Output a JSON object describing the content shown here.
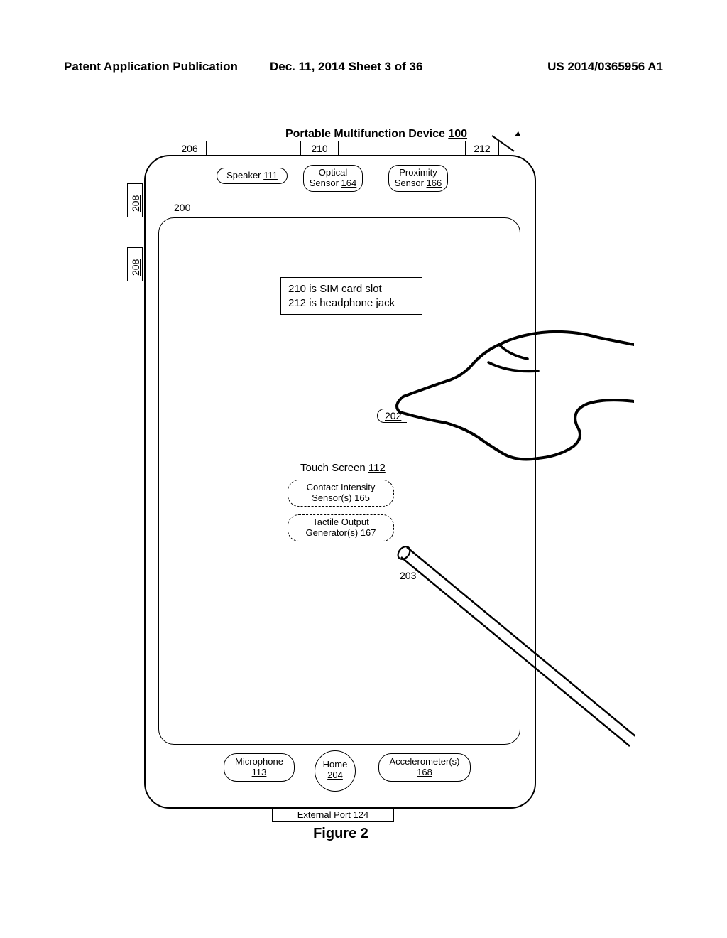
{
  "header": {
    "left": "Patent Application Publication",
    "center": "Dec. 11, 2014  Sheet 3 of 36",
    "right": "US 2014/0365956 A1"
  },
  "figure": {
    "title_prefix": "Portable Multifunction Device ",
    "title_ref": "100",
    "caption": "Figure 2",
    "refs": {
      "r206": "206",
      "r210": "210",
      "r212": "212",
      "r208": "208",
      "r200": "200",
      "r202": "202",
      "r203": "203"
    },
    "speaker_label": "Speaker ",
    "speaker_ref": "111",
    "optical_label": "Optical Sensor ",
    "optical_ref": "164",
    "proximity_label": "Proximity Sensor ",
    "proximity_ref": "166",
    "note_line1": "210 is SIM card slot",
    "note_line2": "212 is headphone jack",
    "touch_screen_label": "Touch Screen ",
    "touch_screen_ref": "112",
    "contact_label": "Contact Intensity Sensor(s) ",
    "contact_ref": "165",
    "tactile_label": "Tactile Output Generator(s) ",
    "tactile_ref": "167",
    "mic_label": "Microphone",
    "mic_ref": "113",
    "home_label": "Home",
    "home_ref": "204",
    "accel_label": "Accelerometer(s)",
    "accel_ref": "168",
    "ext_port_label": "External Port ",
    "ext_port_ref": "124"
  }
}
